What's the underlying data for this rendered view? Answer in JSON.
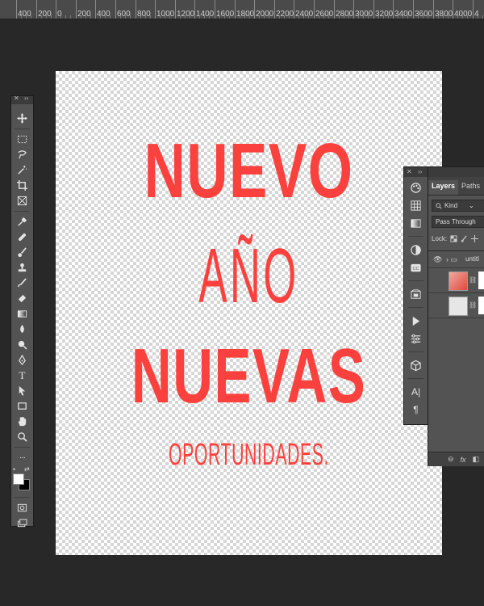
{
  "ruler": {
    "labels": [
      "400",
      "200",
      "0",
      "200",
      "400",
      "600",
      "800",
      "1000",
      "1200",
      "1400",
      "1600",
      "1800",
      "2000",
      "2200",
      "2400",
      "2600",
      "2800",
      "3000",
      "3200",
      "3400",
      "3600",
      "3800",
      "4000",
      "4"
    ]
  },
  "canvas": {
    "lines": [
      "NUEVO",
      "AÑO",
      "NUEVAS",
      "OPORTUNIDADES."
    ],
    "text_color": "#fb413d"
  },
  "tools": [
    {
      "name": "move-tool",
      "icon": "move-icon"
    },
    {
      "name": "marquee-tool",
      "icon": "marquee-icon"
    },
    {
      "name": "lasso-tool",
      "icon": "lasso-icon"
    },
    {
      "name": "magic-wand-tool",
      "icon": "magic-wand-icon"
    },
    {
      "name": "crop-tool",
      "icon": "crop-icon"
    },
    {
      "name": "frame-tool",
      "icon": "frame-icon"
    },
    {
      "name": "eyedropper-tool",
      "icon": "eyedropper-icon"
    },
    {
      "name": "healing-tool",
      "icon": "bandage-icon"
    },
    {
      "name": "brush-tool",
      "icon": "brush-icon"
    },
    {
      "name": "stamp-tool",
      "icon": "stamp-icon"
    },
    {
      "name": "history-brush-tool",
      "icon": "history-brush-icon"
    },
    {
      "name": "eraser-tool",
      "icon": "eraser-icon"
    },
    {
      "name": "gradient-tool",
      "icon": "gradient-icon"
    },
    {
      "name": "blur-tool",
      "icon": "blur-icon"
    },
    {
      "name": "dodge-tool",
      "icon": "dodge-icon"
    },
    {
      "name": "pen-tool",
      "icon": "pen-icon"
    },
    {
      "name": "type-tool",
      "icon": "type-icon",
      "glyph": "T"
    },
    {
      "name": "path-selection-tool",
      "icon": "arrow-icon"
    },
    {
      "name": "shape-tool",
      "icon": "rectangle-icon"
    },
    {
      "name": "hand-tool",
      "icon": "hand-icon"
    },
    {
      "name": "zoom-tool",
      "icon": "zoom-icon"
    },
    {
      "name": "more-tools",
      "icon": "more-icon",
      "glyph": "···"
    }
  ],
  "toolbar": {
    "collapse_glyph": "››",
    "close_glyph": "✕"
  },
  "colors": {
    "foreground": "#ffffff",
    "background": "#000000"
  },
  "panel": {
    "tabs": [
      "Layers",
      "Paths"
    ],
    "active_tab": "Layers",
    "filter_label": "Kind",
    "blend_mode": "Pass Through",
    "lock_label": "Lock:",
    "group_name": "untitl",
    "footer_fx": "fx"
  },
  "strip": {
    "icons": [
      "color-swatches-icon",
      "grid-icon",
      "gradient-swatch-icon",
      "adjustment-icon",
      "cc-libraries-icon",
      "artboard-icon",
      "play-icon",
      "properties-icon",
      "3d-cube-icon",
      "character-icon",
      "paragraph-icon"
    ],
    "glyphs": {
      "character": "A|",
      "paragraph": "¶"
    }
  }
}
